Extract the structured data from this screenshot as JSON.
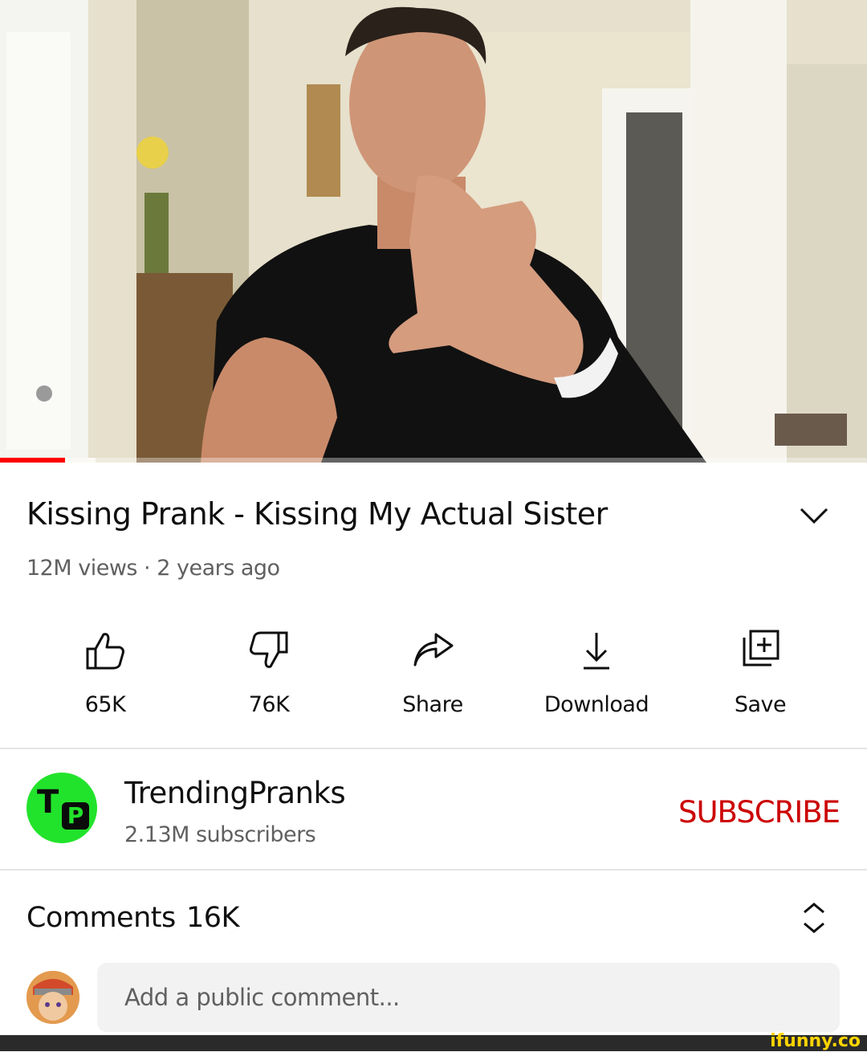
{
  "player": {
    "progress_fraction": 0.075,
    "buffer_fraction": 0.11,
    "colors": {
      "played": "#ff0000"
    }
  },
  "video": {
    "title": "Kissing Prank - Kissing My Actual Sister",
    "meta": "12M views · 2 years ago",
    "expand_icon": "chevron-down-icon"
  },
  "actions": [
    {
      "id": "like",
      "label": "65K",
      "icon": "thumbs-up-icon"
    },
    {
      "id": "dislike",
      "label": "76K",
      "icon": "thumbs-down-icon"
    },
    {
      "id": "share",
      "label": "Share",
      "icon": "share-arrow-icon"
    },
    {
      "id": "download",
      "label": "Download",
      "icon": "download-icon"
    },
    {
      "id": "save",
      "label": "Save",
      "icon": "add-to-playlist-icon"
    }
  ],
  "channel": {
    "name": "TrendingPranks",
    "subscribers": "2.13M subscribers",
    "avatar_letters": {
      "first": "T",
      "second": "P"
    },
    "avatar_color": "#22e32b",
    "subscribe_label": "SUBSCRIBE",
    "subscribe_color": "#cc0000"
  },
  "comments": {
    "label": "Comments",
    "count": "16K",
    "sort_icon": "expand-collapse-icon",
    "input_placeholder": "Add a public comment..."
  },
  "watermark": "ifunny.co"
}
